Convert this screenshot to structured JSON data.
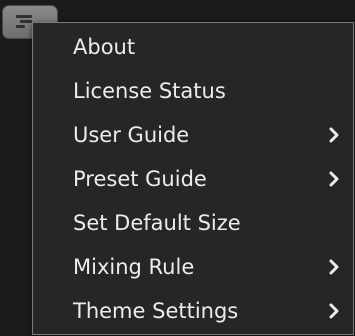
{
  "menu": {
    "items": [
      {
        "label": "About",
        "submenu": false
      },
      {
        "label": "License Status",
        "submenu": false
      },
      {
        "label": "User Guide",
        "submenu": true
      },
      {
        "label": "Preset Guide",
        "submenu": true
      },
      {
        "label": "Set Default Size",
        "submenu": false
      },
      {
        "label": "Mixing Rule",
        "submenu": true
      },
      {
        "label": "Theme Settings",
        "submenu": true
      }
    ]
  },
  "colors": {
    "background": "#1b1b1b",
    "menu_background": "#262626",
    "menu_border": "#7a7a7a",
    "text": "#ececec",
    "button": "#7c7c7c"
  }
}
